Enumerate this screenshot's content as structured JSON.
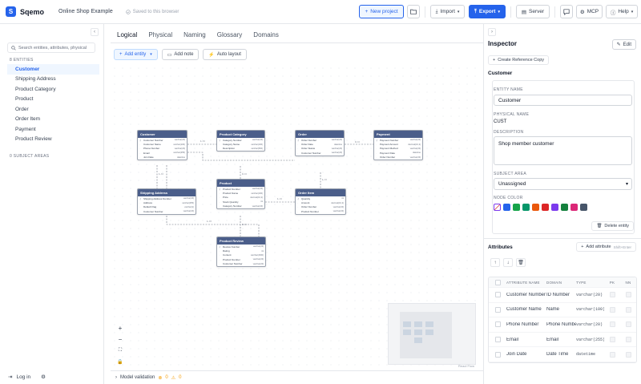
{
  "app": {
    "name": "Sqemo",
    "logo_letter": "S",
    "project_name": "Online Shop Example",
    "saved_status": "Saved to this browser"
  },
  "toolbar": {
    "new_project": "New project",
    "import": "Import",
    "export": "Export",
    "server": "Server",
    "mcp": "MCP",
    "help": "Help"
  },
  "sidebar": {
    "search_placeholder": "Search entities, attributes, physical",
    "entities_label": "8 ENTITIES",
    "entities": [
      "Customer",
      "Shipping Address",
      "Product Category",
      "Product",
      "Order",
      "Order Item",
      "Payment",
      "Product Review"
    ],
    "active_entity": "Customer",
    "subject_areas_label": "0 SUBJECT AREAS",
    "login": "Log in"
  },
  "tabs": [
    "Logical",
    "Physical",
    "Naming",
    "Glossary",
    "Domains"
  ],
  "active_tab": "Logical",
  "canvas_toolbar": {
    "add_entity": "Add entity",
    "add_note": "Add note",
    "auto_layout": "Auto layout"
  },
  "diagram": {
    "entities": {
      "customer": {
        "title": "Customer",
        "rows": [
          [
            "Customer Number",
            "varchar(20)"
          ],
          [
            "Customer Name",
            "varchar(100)"
          ],
          [
            "Phone Number",
            "varchar(20)"
          ],
          [
            "Email",
            "varchar(255)"
          ],
          [
            "Join Date",
            "datetime"
          ]
        ]
      },
      "shipping": {
        "title": "Shipping Address",
        "rows": [
          [
            "Shipping Address Number",
            "varchar(20)"
          ],
          [
            "Address",
            "varchar(255)"
          ],
          [
            "Default Flag",
            "varchar(1)"
          ],
          [
            "Customer Number",
            "varchar(20)"
          ]
        ]
      },
      "category": {
        "title": "Product Category",
        "rows": [
          [
            "Category Number",
            "varchar(20)"
          ],
          [
            "Category Name",
            "varchar(100)"
          ],
          [
            "Description",
            "varchar(500)"
          ]
        ]
      },
      "product": {
        "title": "Product",
        "rows": [
          [
            "Product Number",
            "varchar(20)"
          ],
          [
            "Product Name",
            "varchar(100)"
          ],
          [
            "Price",
            "decimal(10,2)"
          ],
          [
            "Stock Quantity",
            "int"
          ],
          [
            "Category Number",
            "varchar(20)"
          ]
        ]
      },
      "review": {
        "title": "Product Review",
        "rows": [
          [
            "Review Number",
            "varchar(20)"
          ],
          [
            "Rating",
            "int"
          ],
          [
            "Content",
            "varchar(2000)"
          ],
          [
            "Product Number",
            "varchar(20)"
          ],
          [
            "Customer Number",
            "varchar(20)"
          ]
        ]
      },
      "order": {
        "title": "Order",
        "rows": [
          [
            "Order Number",
            "varchar(20)"
          ],
          [
            "Order Date",
            "datetime"
          ],
          [
            "Order Status",
            "varchar(20)"
          ],
          [
            "Customer Number",
            "varchar(20)"
          ]
        ]
      },
      "orderitem": {
        "title": "Order Item",
        "rows": [
          [
            "Quantity",
            "int"
          ],
          [
            "Amount",
            "decimal(10,2)"
          ],
          [
            "Order Number",
            "varchar(20)"
          ],
          [
            "Product Number",
            "varchar(20)"
          ]
        ]
      },
      "payment": {
        "title": "Payment",
        "rows": [
          [
            "Payment Number",
            "varchar(20)"
          ],
          [
            "Payment Amount",
            "decimal(10,2)"
          ],
          [
            "Payment Method",
            "varchar(20)"
          ],
          [
            "Payment Date",
            "datetime"
          ],
          [
            "Order Number",
            "varchar(20)"
          ]
        ]
      }
    },
    "rel_labels": [
      "1..N",
      "1..N",
      "0..N",
      "1..N",
      "0..N",
      "1..N",
      "0..N",
      "1..N"
    ]
  },
  "react_flow": "React Flow",
  "validation": {
    "label": "Model validation",
    "errors": "0",
    "warnings": "0"
  },
  "inspector": {
    "title": "Inspector",
    "edit": "Edit",
    "create_ref": "Create Reference Copy",
    "entity_heading": "Customer",
    "entity_name_label": "ENTITY NAME",
    "entity_name": "Customer",
    "physical_name_label": "PHYSICAL NAME",
    "physical_name": "CUST",
    "description_label": "DESCRIPTION",
    "description": "Shop member customer",
    "subject_area_label": "SUBJECT AREA",
    "subject_area": "Unassigned",
    "node_color_label": "NODE COLOR",
    "node_colors": [
      "#ffffff",
      "#2563eb",
      "#16a34a",
      "#059669",
      "#ea580c",
      "#dc2626",
      "#7c3aed",
      "#15803d",
      "#db2777",
      "#475569"
    ],
    "delete_entity": "Delete entity",
    "attributes_heading": "Attributes",
    "add_attribute": "Add attribute",
    "shortcut": "Shift+Enter",
    "columns": [
      "ATTRIBUTE NAME",
      "DOMAIN",
      "TYPE",
      "PK",
      "NN"
    ],
    "attributes": [
      {
        "name": "Customer Number",
        "domain": "ID Number",
        "type": "varchar(20)"
      },
      {
        "name": "Customer Name",
        "domain": "Name",
        "type": "varchar(100)"
      },
      {
        "name": "Phone Number",
        "domain": "Phone Number",
        "type": "varchar(20)"
      },
      {
        "name": "Email",
        "domain": "Email",
        "type": "varchar(255)"
      },
      {
        "name": "Join Date",
        "domain": "Date Time",
        "type": "datetime"
      }
    ]
  }
}
